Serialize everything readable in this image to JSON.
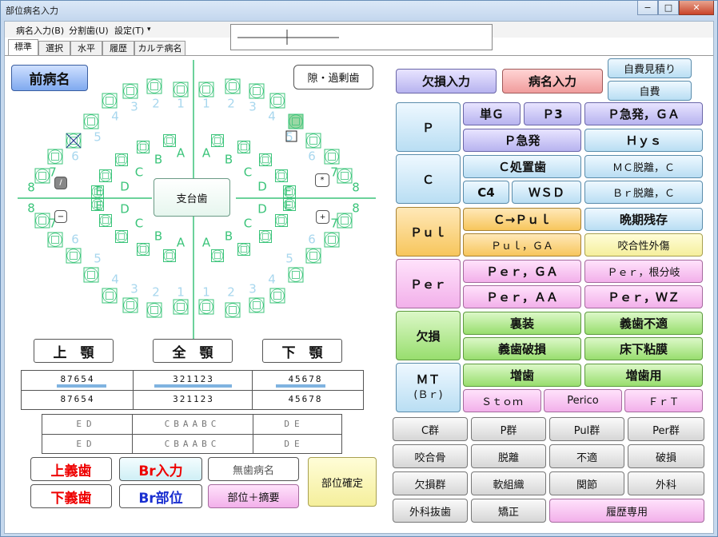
{
  "window": {
    "title": "部位病名入力",
    "minimize": "−",
    "maximize": "□",
    "close": "✕"
  },
  "menu": [
    "病名入力(B)",
    "分割歯(U)",
    "設定(T)"
  ],
  "menu_arrow": "▾",
  "tabs": [
    "標準",
    "選択",
    "水平",
    "履歴",
    "カルテ病名"
  ],
  "chart": {
    "prev_button": "前病名",
    "gap_button": "隙・過剰歯",
    "abutment_button": "支台歯",
    "upper_button": "上　顎",
    "full_button": "全　顎",
    "lower_button": "下　顎",
    "side_buttons": [
      "/",
      "*",
      "−",
      "+"
    ],
    "permanent_labels": [
      "8",
      "7",
      "6",
      "5",
      "4",
      "3",
      "2",
      "1",
      "1",
      "2",
      "3",
      "4",
      "5",
      "6",
      "7",
      "8"
    ],
    "deciduous_labels": [
      "E",
      "D",
      "C",
      "B",
      "A",
      "A",
      "B",
      "C",
      "D",
      "E"
    ]
  },
  "tooth_table": {
    "row1": {
      "left": "87654",
      "center": "321123",
      "right": "45678"
    },
    "row2": {
      "left": "87654",
      "center": "321123",
      "right": "45678"
    },
    "ed_row1": {
      "left": "ED",
      "center": "CBAABC",
      "right": "DE"
    },
    "ed_row2": {
      "left": "ED",
      "center": "CBAABC",
      "right": "DE"
    }
  },
  "bottom_left": {
    "upper_denture": "上義歯",
    "lower_denture": "下義歯",
    "br_input": "Br入力",
    "br_part": "Br部位",
    "no_tooth": "無歯病名",
    "part_summary": "部位＋摘要",
    "confirm": "部位確定"
  },
  "top_right": {
    "defect_input": "欠損入力",
    "disease_input": "病名入力",
    "self_estimate": "自費見積り",
    "self_pay": "自費"
  },
  "categories": {
    "P": "Ｐ",
    "C": "Ｃ",
    "Pul": "Ｐｕｌ",
    "Per": "Ｐｅｒ",
    "defect": "欠損",
    "MT": "ＭＴ",
    "Br": "(Ｂｒ)"
  },
  "p_buttons": [
    "単Ｇ",
    "Ｐ3",
    "Ｐ急発，ＧＡ",
    "Ｐ急発",
    "Ｈｙｓ"
  ],
  "c_buttons": [
    "Ｃ処置歯",
    "ＭＣ脱離，Ｃ",
    "C4",
    "ＷＳＤ",
    "Ｂｒ脱離，Ｃ"
  ],
  "pul_buttons": [
    "Ｃ→Ｐｕｌ",
    "晩期残存",
    "Ｐｕｌ，ＧＡ",
    "咬合性外傷"
  ],
  "per_buttons": [
    "Ｐｅｒ，ＧＡ",
    "Ｐｅｒ，根分岐",
    "Ｐｅｒ，ＡＡ",
    "Ｐｅｒ，ＷＺ"
  ],
  "defect_buttons": [
    "裏装",
    "義歯不適",
    "義歯破損",
    "床下粘膜"
  ],
  "mt_buttons": [
    "増歯",
    "増歯用",
    "Ｓｔｏｍ",
    "Perico",
    "ＦｒＴ"
  ],
  "grid_buttons": [
    "C群",
    "P群",
    "Pul群",
    "Per群",
    "咬合骨",
    "脱離",
    "不適",
    "破損",
    "欠損群",
    "軟組織",
    "関節",
    "外科",
    "外科抜歯",
    "矯正",
    "履歴専用"
  ]
}
